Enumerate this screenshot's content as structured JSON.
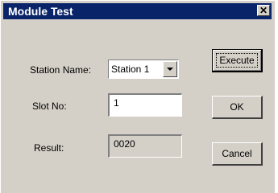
{
  "window": {
    "title": "Module Test",
    "close_glyph": "✕"
  },
  "form": {
    "station_label": "Station Name:",
    "station_value": "Station 1",
    "slot_label": "Slot No:",
    "slot_value": "1",
    "result_label": "Result:",
    "result_value": "0020"
  },
  "buttons": {
    "execute": "Execute",
    "ok": "OK",
    "cancel": "Cancel"
  },
  "icons": {
    "close": "close-icon",
    "dropdown": "chevron-down-icon"
  },
  "colors": {
    "title_bar": "#0a246a",
    "face": "#d4d0c8"
  }
}
